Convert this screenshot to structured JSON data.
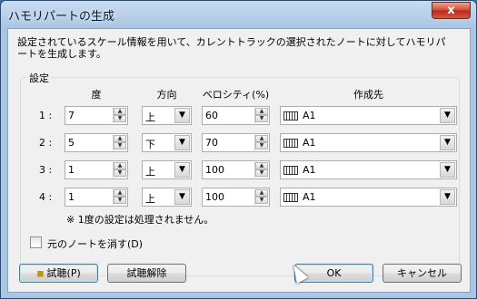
{
  "window": {
    "title": "ハモリパートの生成",
    "close": "x"
  },
  "description": "設定されているスケール情報を用いて、カレントトラックの選択されたノートに対してハモリパートを生成します。",
  "settings": {
    "group_label": "設定",
    "headers": {
      "degree": "度",
      "direction": "方向",
      "velocity": "ベロシティ(%)",
      "target": "作成先"
    },
    "rows": [
      {
        "label": "1 :",
        "degree": "7",
        "direction": "上",
        "velocity": "60",
        "target": "A1"
      },
      {
        "label": "2 :",
        "degree": "5",
        "direction": "下",
        "velocity": "70",
        "target": "A1"
      },
      {
        "label": "3 :",
        "degree": "1",
        "direction": "上",
        "velocity": "100",
        "target": "A1"
      },
      {
        "label": "4 :",
        "degree": "1",
        "direction": "上",
        "velocity": "100",
        "target": "A1"
      }
    ],
    "note": "※ 1度の設定は処理されません。",
    "erase_original_label": "元のノートを消す(D)",
    "erase_original_checked": false
  },
  "buttons": {
    "preview": "試聴(P)",
    "cancel_preview": "試聴解除",
    "ok": "OK",
    "cancel": "キャンセル"
  },
  "icons": {
    "speaker": "speaker-icon",
    "track": "track-icon",
    "spin_up": "▲",
    "spin_down": "▼",
    "dropdown": "▼"
  }
}
